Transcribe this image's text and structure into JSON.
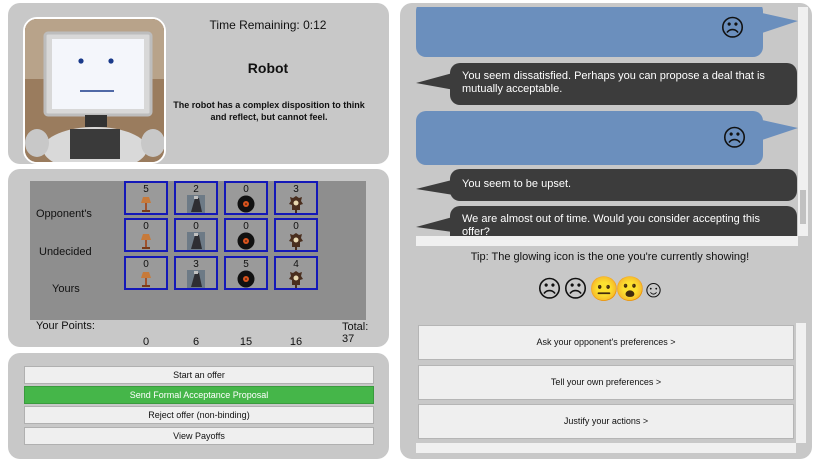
{
  "colors": {
    "panel_bg": "#c8c8c8",
    "board_bg": "#8e8e8e",
    "cell_border": "#1418b8",
    "accept_green": "#45b649",
    "user_bubble": "#6b8fbd",
    "agent_bubble": "#3c3c3c"
  },
  "header": {
    "timer": "Time Remaining: 0:12",
    "name": "Robot",
    "description": "The robot has a complex disposition to think and reflect, but cannot feel."
  },
  "board": {
    "row_labels": [
      "Opponent's",
      "Undecided",
      "Yours",
      "Your Points:"
    ],
    "items": [
      "lamp-icon",
      "record-player-icon",
      "vinyl-record-icon",
      "clock-icon"
    ],
    "opponent": [
      "5",
      "2",
      "0",
      "3"
    ],
    "undecided": [
      "0",
      "0",
      "0",
      "0"
    ],
    "yours": [
      "0",
      "3",
      "5",
      "4"
    ],
    "points": [
      "0",
      "6",
      "15",
      "16"
    ],
    "total": "Total: 37"
  },
  "actions": {
    "start_offer": "Start an offer",
    "send_acceptance": "Send Formal Acceptance Proposal",
    "reject_offer": "Reject offer (non-binding)",
    "view_payoffs": "View Payoffs"
  },
  "chat": {
    "messages": [
      {
        "from": "user",
        "emoji": "☹"
      },
      {
        "from": "agent",
        "text": "You seem dissatisfied. Perhaps you can propose a deal that is mutually acceptable."
      },
      {
        "from": "user",
        "emoji": "☹"
      },
      {
        "from": "agent",
        "text": "You seem to be upset."
      },
      {
        "from": "agent",
        "text": "We are almost out of time. Would you consider accepting this offer?"
      }
    ]
  },
  "tip": "Tip: The glowing icon is the one you're currently showing!",
  "emotions": [
    "☹",
    "☹",
    "😐",
    "😮",
    "☺"
  ],
  "preferences": {
    "ask": "Ask your opponent's preferences >",
    "tell": "Tell your own preferences >",
    "justify": "Justify your actions >"
  }
}
